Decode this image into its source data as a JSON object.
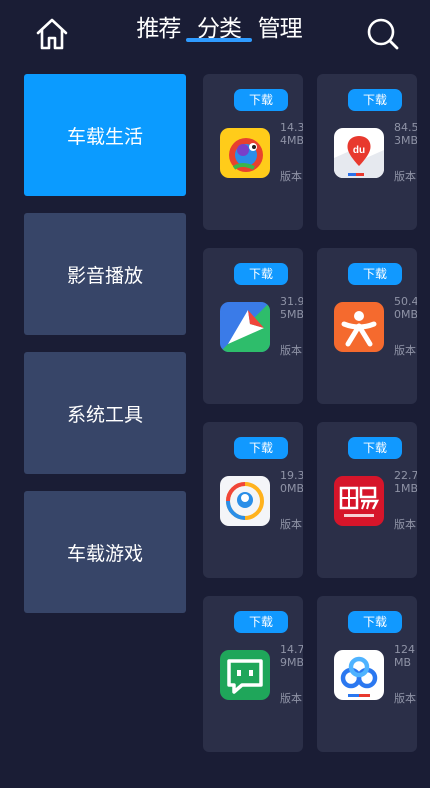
{
  "header": {
    "tabs": [
      "推荐",
      "分类",
      "管理"
    ],
    "active_tab": "分类",
    "home_icon": "home-icon",
    "search_icon": "search-icon",
    "accent_color": "#2f9bff"
  },
  "categories": [
    {
      "label": "车载生活",
      "active": true
    },
    {
      "label": "影音播放",
      "active": false
    },
    {
      "label": "系统工具",
      "active": false
    },
    {
      "label": "车载游戏",
      "active": false
    }
  ],
  "apps": [
    {
      "download": "下载",
      "size": "14.34MB",
      "version": "版本",
      "icon": "chameleon-app-icon"
    },
    {
      "download": "下载",
      "size": "84.53MB",
      "version": "版本",
      "icon": "baidu-map-icon"
    },
    {
      "download": "下载",
      "size": "31.95MB",
      "version": "版本",
      "icon": "navigation-app-icon"
    },
    {
      "download": "下载",
      "size": "50.40MB",
      "version": "版本",
      "icon": "person-app-icon"
    },
    {
      "download": "下载",
      "size": "19.30MB",
      "version": "版本",
      "icon": "tencent-news-icon"
    },
    {
      "download": "下载",
      "size": "22.71MB",
      "version": "版本",
      "icon": "netease-news-icon"
    },
    {
      "download": "下载",
      "size": "14.79MB",
      "version": "版本",
      "icon": "chat-bot-app-icon"
    },
    {
      "download": "下载",
      "size": "124MB",
      "version": "版本",
      "icon": "baidu-netdisk-icon"
    }
  ],
  "colors": {
    "background": "#1a1d35",
    "category_active": "#0b9bff",
    "category_inactive": "#374568",
    "card": "#2b2f48",
    "download_button": "#1199ff"
  }
}
